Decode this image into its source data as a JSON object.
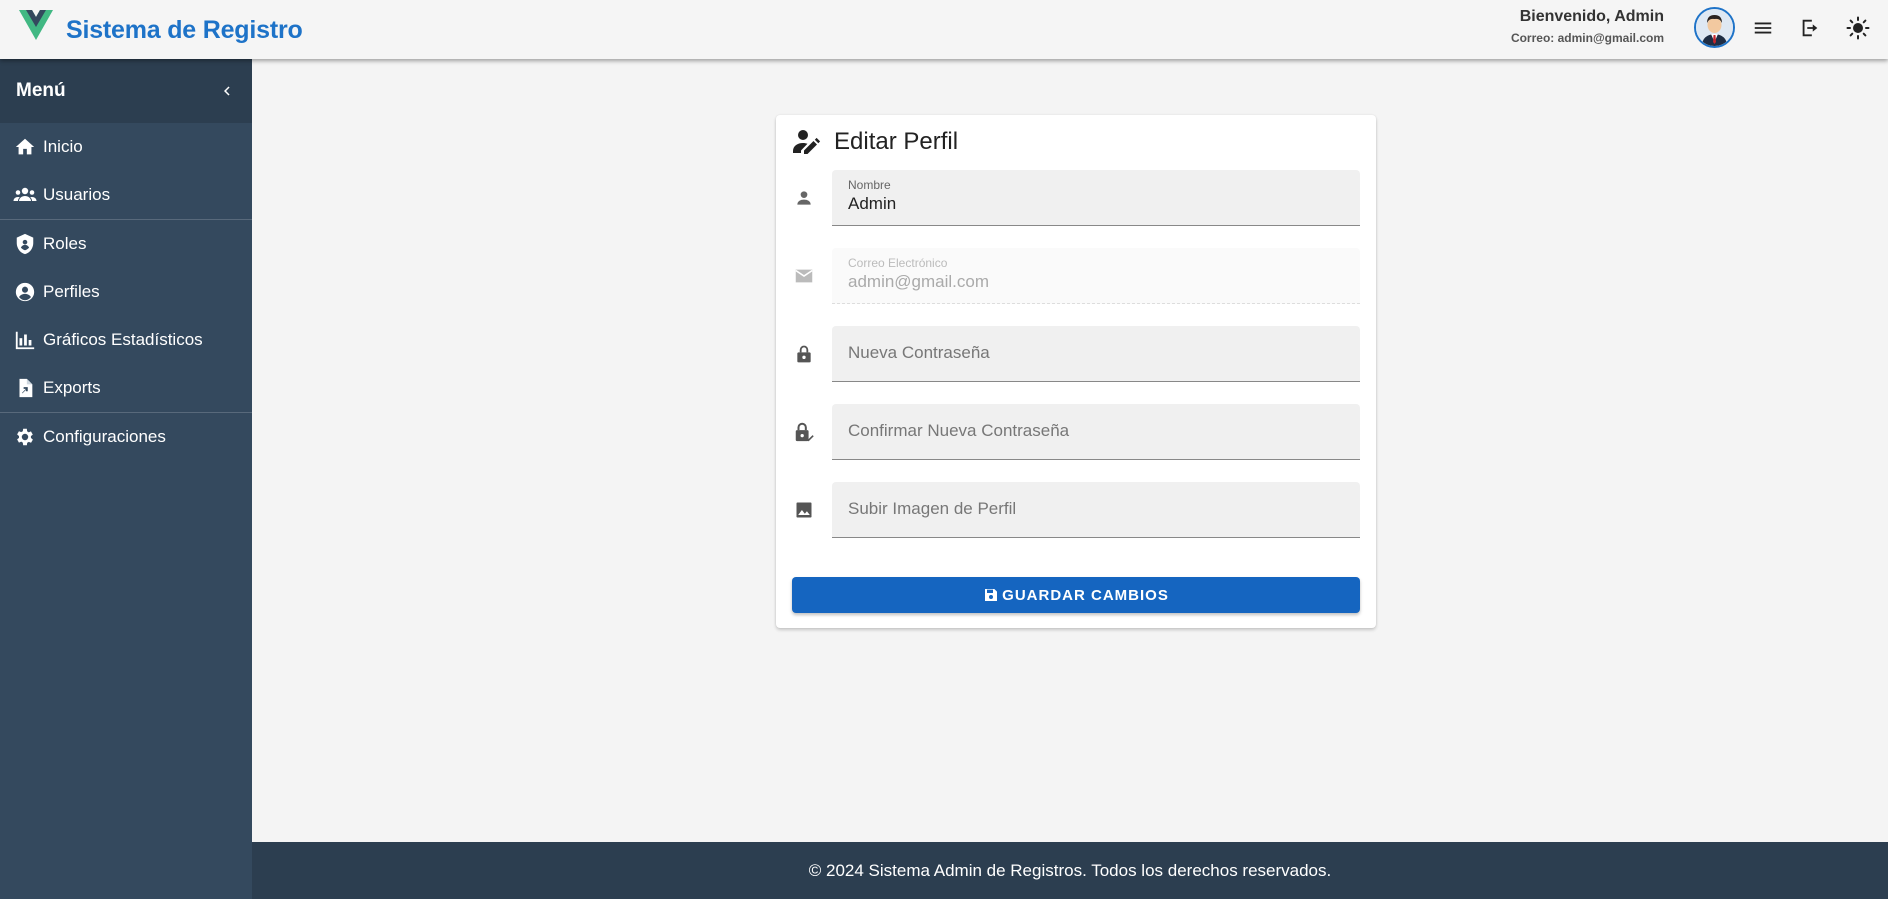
{
  "header": {
    "brand": "Sistema de Registro",
    "welcome": "Bienvenido, Admin",
    "email": "Correo: admin@gmail.com",
    "icons": [
      "vue-logo-icon",
      "avatar",
      "menu-icon",
      "logout-icon",
      "brightness-icon"
    ]
  },
  "sidebar": {
    "title": "Menú",
    "collapse_icon": "chevron-left-icon",
    "items": [
      {
        "label": "Inicio",
        "icon": "home-icon"
      },
      {
        "label": "Usuarios",
        "icon": "users-icon"
      },
      {
        "label": "Roles",
        "icon": "shield-icon"
      },
      {
        "label": "Perfiles",
        "icon": "account-circle-icon"
      },
      {
        "label": "Gráficos Estadísticos",
        "icon": "bar-chart-icon"
      },
      {
        "label": "Exports",
        "icon": "file-export-icon"
      },
      {
        "label": "Configuraciones",
        "icon": "gear-icon"
      }
    ]
  },
  "card": {
    "title": "Editar Perfil",
    "fields": {
      "nombre": {
        "label": "Nombre",
        "value": "Admin",
        "icon": "person-icon"
      },
      "correo": {
        "label": "Correo Electrónico",
        "value": "admin@gmail.com",
        "icon": "email-icon",
        "disabled": true
      },
      "password": {
        "placeholder": "Nueva Contraseña",
        "icon": "lock-icon"
      },
      "confirm": {
        "placeholder": "Confirmar Nueva Contraseña",
        "icon": "lock-check-icon"
      },
      "image": {
        "placeholder": "Subir Imagen de Perfil",
        "icon": "image-icon"
      }
    },
    "save_label": "GUARDAR CAMBIOS"
  },
  "footer": {
    "text": "© 2024 Sistema Admin de Registros. Todos los derechos reservados."
  },
  "colors": {
    "brand": "#1e73c8",
    "sidebar": "#34495e",
    "sidebar_head": "#2c3e50",
    "primary_button": "#1565c0"
  }
}
